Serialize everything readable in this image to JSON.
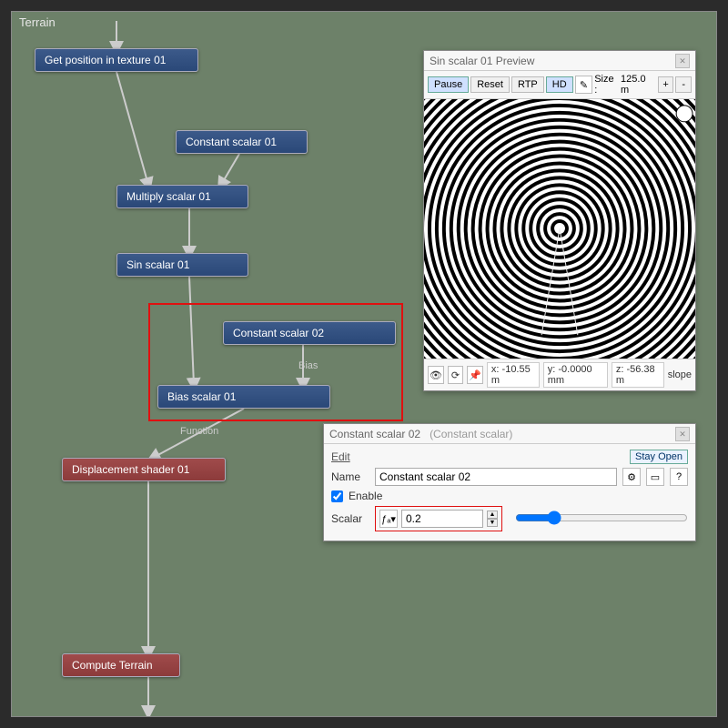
{
  "canvas": {
    "title": "Terrain"
  },
  "nodes": {
    "getpos": "Get position in texture 01",
    "const1": "Constant scalar 01",
    "mult": "Multiply scalar 01",
    "sin": "Sin scalar 01",
    "const2": "Constant scalar 02",
    "bias": "Bias scalar 01",
    "disp": "Displacement shader 01",
    "compute": "Compute Terrain"
  },
  "edge_labels": {
    "bias": "Bias",
    "function": "Function"
  },
  "preview": {
    "title": "Sin scalar 01 Preview",
    "pause": "Pause",
    "reset": "Reset",
    "rtp": "RTP",
    "hd": "HD",
    "size_label": "Size : ",
    "size_value": "125.0 m",
    "plus": "+",
    "minus": "-",
    "status": {
      "x": "x: -10.55 m",
      "y": "y: -0.0000 mm",
      "z": "z: -56.38 m",
      "slope": "slope"
    }
  },
  "props": {
    "title": "Constant scalar 02",
    "subtitle": "(Constant scalar)",
    "edit": "Edit",
    "stay_open": "Stay Open",
    "name_label": "Name",
    "name_value": "Constant scalar 02",
    "enable_label": "Enable",
    "scalar_label": "Scalar",
    "scalar_value": "0.2",
    "help": "?"
  }
}
